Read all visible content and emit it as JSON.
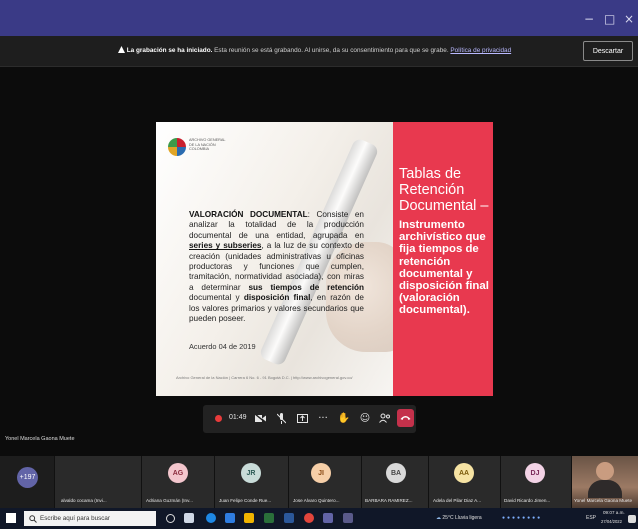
{
  "window": {
    "minimize": "−",
    "restore": "□",
    "close": "×"
  },
  "notification": {
    "bold": "La grabación se ha iniciado.",
    "text": " Esta reunión se está grabando. Al unirse, da su consentimiento para que se grabe. ",
    "link": "Política de privacidad",
    "dismiss_label": "Descartar"
  },
  "slide": {
    "logo_text": "ARCHIVO GENERAL DE LA NACIÓN COLOMBIA",
    "term": "VALORACIÓN DOCUMENTAL",
    "def_1": ": Consiste en analizar la totalidad de la producción documental de una entidad, agrupada en ",
    "series": "series y subseries",
    "def_2": ", a la luz de su contexto de creación (unidades administrativas u oficinas productoras y funciones que cumplen, tramitación, normatividad asociada), con miras a determinar ",
    "tiempos": "sus tiempos de retención",
    "def_3": " documental y ",
    "disposicion": "disposición final",
    "def_4": ", en razón de los valores primarios y valores secundarios que pueden poseer.",
    "acuerdo": "Acuerdo 04 de 2019",
    "footer": "Archivo General de la Nación  |  Carrera 6 No. 6 - 91 Bogotá D.C.  |  http://www.archivogeneral.gov.co/",
    "right_title": "Tablas de Retención Documental –",
    "right_body": "Instrumento archivístico que fija tiempos de retención documental y disposición final (valoración documental)."
  },
  "controls": {
    "timer": "01:49",
    "more": "···"
  },
  "speaker_name": "Yonel Marcela Gaona Muete",
  "participants": {
    "more_count": "+197",
    "tiles": [
      {
        "name": "alvaldo cocama (Invi...",
        "initials": "",
        "color": "#3a3a3a"
      },
      {
        "name": "Adriana Guzmán (Inv...",
        "initials": "AG",
        "color": "#f3c6cd"
      },
      {
        "name": "Juan Felipe Conde Rue...",
        "initials": "JR",
        "color": "#c9dcd9"
      },
      {
        "name": "Jose Alvaro Quintero...",
        "initials": "JI",
        "color": "#f6cfa8"
      },
      {
        "name": "BARBARA RAMIREZ...",
        "initials": "BA",
        "color": "#d9d9d9"
      },
      {
        "name": "Adela del Pilar Diaz A...",
        "initials": "AA",
        "color": "#f6e3a3"
      },
      {
        "name": "David Ricardo Jimen...",
        "initials": "DJ",
        "color": "#f3d3e6"
      },
      {
        "name": "Yonel Marcela Gaona Muete",
        "initials": "",
        "color": "#8a6a58"
      }
    ]
  },
  "taskbar": {
    "search_placeholder": "Escribe aquí para buscar",
    "weather": "25°C  Lluvia ligera",
    "lang": "ESP",
    "time": "09:07 a.m.",
    "date": "27/04/2022"
  }
}
